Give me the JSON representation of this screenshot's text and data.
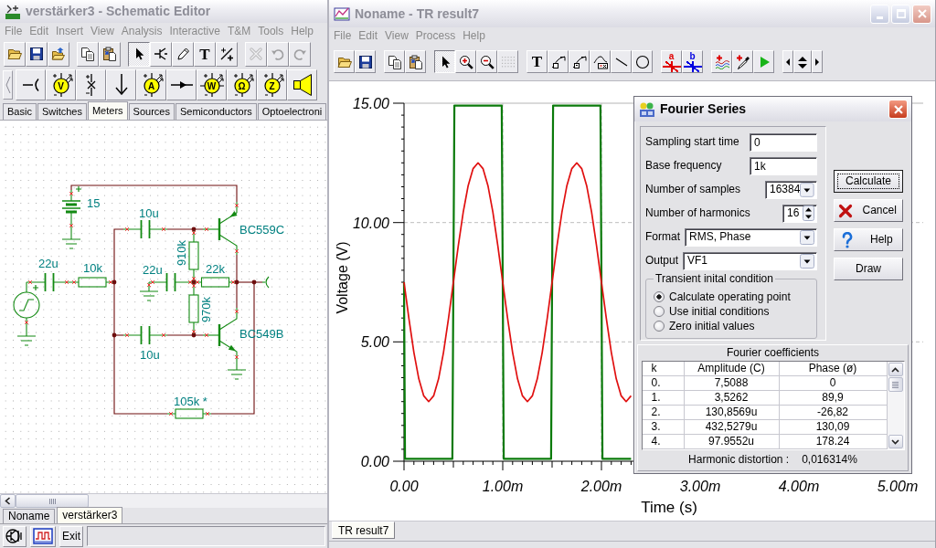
{
  "schematic_window": {
    "active": false,
    "title": "verstärker3 - Schematic Editor",
    "menu": [
      "File",
      "Edit",
      "Insert",
      "View",
      "Analysis",
      "Interactive",
      "T&M",
      "Tools",
      "Help"
    ],
    "toolbar": [
      [
        {
          "kind": "open",
          "selected": false,
          "disabled": false
        },
        {
          "kind": "save",
          "selected": false,
          "disabled": false
        },
        {
          "kind": "import",
          "selected": false,
          "disabled": false
        }
      ],
      [
        {
          "kind": "copy",
          "selected": false,
          "disabled": false
        },
        {
          "kind": "paste",
          "selected": false,
          "disabled": false
        }
      ],
      [
        {
          "kind": "pointer",
          "selected": true,
          "disabled": false
        },
        {
          "kind": "wire",
          "selected": false,
          "disabled": false
        },
        {
          "kind": "pencil",
          "selected": false,
          "disabled": false
        },
        {
          "kind": "text",
          "glyph": "T",
          "selected": false,
          "disabled": false
        },
        {
          "kind": "part",
          "selected": false,
          "disabled": false
        }
      ],
      [
        {
          "kind": "delete",
          "selected": false,
          "disabled": true
        },
        {
          "kind": "undo",
          "selected": false,
          "disabled": true
        },
        {
          "kind": "redo",
          "selected": false,
          "disabled": true
        }
      ]
    ],
    "component_toolbar": [
      {
        "kind": "terminal"
      },
      {
        "kind": "meter",
        "glyph": "V"
      },
      {
        "kind": "probe"
      },
      {
        "kind": "arrow"
      },
      {
        "kind": "meter",
        "glyph": "A"
      },
      {
        "kind": "pin"
      },
      {
        "kind": "wattmeter",
        "glyph": "W"
      },
      {
        "kind": "meter",
        "glyph": "Ω"
      },
      {
        "kind": "meter",
        "glyph": "Z"
      },
      {
        "kind": "speaker"
      }
    ],
    "category_tabs": [
      {
        "label": "Basic",
        "selected": false
      },
      {
        "label": "Switches",
        "selected": false
      },
      {
        "label": "Meters",
        "selected": true
      },
      {
        "label": "Sources",
        "selected": false
      },
      {
        "label": "Semiconductors",
        "selected": false
      },
      {
        "label": "Optoelectroni",
        "selected": false
      }
    ],
    "components": [
      {
        "kind": "battery",
        "label": "15"
      },
      {
        "kind": "capacitor",
        "label": "10u"
      },
      {
        "kind": "pnp",
        "label": "BC559C"
      },
      {
        "kind": "capacitor",
        "label": "22u"
      },
      {
        "kind": "resistor",
        "label": "10k"
      },
      {
        "kind": "capacitor",
        "label": "22u"
      },
      {
        "kind": "resistor",
        "label": "910k"
      },
      {
        "kind": "resistor",
        "label": "22k"
      },
      {
        "kind": "resistor",
        "label": "970k"
      },
      {
        "kind": "npn",
        "label": "BC549B"
      },
      {
        "kind": "capacitor",
        "label": "10u"
      },
      {
        "kind": "resistor",
        "label": "105k *"
      }
    ],
    "document_tabs": [
      {
        "label": "Noname",
        "selected": false
      },
      {
        "label": "verstärker3",
        "selected": true
      }
    ],
    "exit_button": "Exit"
  },
  "result_window": {
    "active": false,
    "title": "Noname - TR result7",
    "menu": [
      "File",
      "Edit",
      "View",
      "Process",
      "Help"
    ],
    "toolbar": [
      [
        {
          "kind": "open",
          "selected": false,
          "disabled": false
        },
        {
          "kind": "save",
          "selected": false,
          "disabled": false
        }
      ],
      [
        {
          "kind": "copy",
          "selected": false,
          "disabled": false
        },
        {
          "kind": "paste",
          "selected": false,
          "disabled": false
        }
      ],
      [
        {
          "kind": "pointer",
          "selected": true,
          "disabled": false
        },
        {
          "kind": "zoom-in",
          "selected": false,
          "disabled": false
        },
        {
          "kind": "zoom-out",
          "selected": false,
          "disabled": false
        },
        {
          "kind": "grid",
          "selected": false,
          "disabled": true
        }
      ],
      [
        {
          "kind": "text",
          "glyph": "T",
          "selected": false,
          "disabled": false
        },
        {
          "kind": "curve-label",
          "selected": false,
          "disabled": false
        },
        {
          "kind": "curve-box",
          "selected": false,
          "disabled": false
        },
        {
          "kind": "curve-legend",
          "selected": false,
          "disabled": false
        },
        {
          "kind": "line",
          "selected": false,
          "disabled": false
        },
        {
          "kind": "circle",
          "selected": false,
          "disabled": false
        }
      ],
      [
        {
          "kind": "cursor",
          "glyph": "a",
          "color": "#e00000",
          "selected": false,
          "disabled": false
        },
        {
          "kind": "cursor",
          "glyph": "b",
          "color": "#0000e0",
          "selected": false,
          "disabled": false
        }
      ],
      [
        {
          "kind": "add-waves",
          "selected": false,
          "disabled": false
        },
        {
          "kind": "eyedropper",
          "selected": false,
          "disabled": false
        },
        {
          "kind": "run",
          "selected": false,
          "disabled": false
        }
      ],
      [
        {
          "kind": "nav-left",
          "selected": false,
          "disabled": false
        },
        {
          "kind": "nav-updown",
          "selected": false,
          "disabled": false
        },
        {
          "kind": "nav-right",
          "selected": false,
          "disabled": false
        }
      ]
    ],
    "chart_data": {
      "type": "line",
      "xlabel": "Time (s)",
      "ylabel": "Voltage (V)",
      "grid": true,
      "x": [
        0,
        0.01,
        0.05,
        0.1,
        0.15,
        0.2,
        0.25,
        0.3,
        0.35,
        0.4,
        0.45,
        0.49,
        0.51,
        0.55,
        0.6,
        0.65,
        0.7,
        0.75,
        0.8,
        0.85,
        0.9,
        0.95,
        0.99,
        1.01,
        1.05,
        1.1,
        1.15,
        1.2,
        1.25,
        1.3,
        1.35,
        1.4,
        1.45,
        1.49,
        1.51,
        1.55,
        1.6,
        1.65,
        1.7,
        1.75,
        1.8,
        1.85,
        1.9,
        1.95,
        1.99,
        2.01,
        2.05,
        2.1,
        2.15,
        2.2,
        2.25,
        2.3
      ],
      "series": [
        {
          "color": "#0a7a0a",
          "values": [
            7.5,
            0.1,
            0.1,
            0.1,
            0.1,
            0.1,
            0.1,
            0.1,
            0.1,
            0.1,
            0.1,
            0.1,
            14.9,
            14.9,
            14.9,
            14.9,
            14.9,
            14.9,
            14.9,
            14.9,
            14.9,
            14.9,
            14.9,
            0.1,
            0.1,
            0.1,
            0.1,
            0.1,
            0.1,
            0.1,
            0.1,
            0.1,
            0.1,
            0.1,
            14.9,
            14.9,
            14.9,
            14.9,
            14.9,
            14.9,
            14.9,
            14.9,
            14.9,
            14.9,
            14.9,
            0.1,
            0.1,
            0.1,
            0.1,
            0.1,
            0.1,
            0.1
          ]
        },
        {
          "color": "#e01010",
          "values": [
            7.5,
            7.19,
            5.96,
            4.56,
            3.45,
            2.74,
            2.5,
            2.74,
            3.45,
            4.56,
            5.96,
            7.19,
            7.81,
            9.04,
            10.44,
            11.55,
            12.26,
            12.5,
            12.26,
            11.55,
            10.44,
            9.04,
            7.81,
            7.19,
            5.96,
            4.56,
            3.45,
            2.74,
            2.5,
            2.74,
            3.45,
            4.56,
            5.96,
            7.19,
            7.81,
            9.04,
            10.44,
            11.55,
            12.26,
            12.5,
            12.26,
            11.55,
            10.44,
            9.04,
            7.81,
            7.19,
            5.96,
            4.56,
            3.45,
            2.74,
            2.5,
            2.74
          ]
        }
      ],
      "xlim": [
        0,
        5
      ],
      "ylim": [
        0,
        15
      ],
      "xticks": [
        {
          "value": 0,
          "label": "0.00"
        },
        {
          "value": 1,
          "label": "1.00m"
        },
        {
          "value": 2,
          "label": "2.00m"
        },
        {
          "value": 3,
          "label": "3.00m"
        },
        {
          "value": 4,
          "label": "4.00m"
        },
        {
          "value": 5,
          "label": "5.00m"
        }
      ],
      "yticks": [
        {
          "value": 0,
          "label": "0.00"
        },
        {
          "value": 5,
          "label": "5.00"
        },
        {
          "value": 10,
          "label": "10.00"
        },
        {
          "value": 15,
          "label": "15.00"
        }
      ]
    },
    "tabs": [
      {
        "label": "TR result7",
        "selected": true
      }
    ]
  },
  "fourier_dialog": {
    "active": true,
    "title": "Fourier Series",
    "fields": [
      {
        "kind": "text",
        "label": "Sampling start time",
        "value": "0"
      },
      {
        "kind": "text",
        "label": "Base frequency",
        "value": "1k"
      },
      {
        "kind": "dropdown",
        "label": "Number of samples",
        "value": "16384"
      },
      {
        "kind": "spinner",
        "label": "Number of harmonics",
        "value": "16"
      },
      {
        "kind": "dropdown",
        "label": "Format",
        "value": "RMS, Phase"
      },
      {
        "kind": "dropdown",
        "label": "Output",
        "value": "VF1"
      }
    ],
    "initial_condition": {
      "title": "Transient inital condition",
      "options": [
        {
          "label": "Calculate operating point",
          "selected": true
        },
        {
          "label": "Use initial conditions",
          "selected": false
        },
        {
          "label": "Zero initial values",
          "selected": false
        }
      ]
    },
    "buttons": [
      {
        "kind": "default",
        "label": "Calculate"
      },
      {
        "kind": "cancel",
        "label": "Cancel"
      },
      {
        "kind": "help",
        "label": "Help"
      },
      {
        "kind": "plain",
        "label": "Draw"
      }
    ],
    "coefficients": {
      "title": "Fourier coefficients",
      "columns": [
        "k",
        "Amplitude (C)",
        "Phase (ø)"
      ],
      "rows": [
        [
          "0.",
          "7,5088",
          "0"
        ],
        [
          "1.",
          "3,5262",
          "89,9"
        ],
        [
          "2.",
          "130,8569u",
          "-26,82"
        ],
        [
          "3.",
          "432,5279u",
          "130,09"
        ],
        [
          "4.",
          "97.9552u",
          "178.24"
        ]
      ]
    },
    "distortion": {
      "label": "Harmonic distortion :",
      "value": "0,016314%"
    }
  }
}
